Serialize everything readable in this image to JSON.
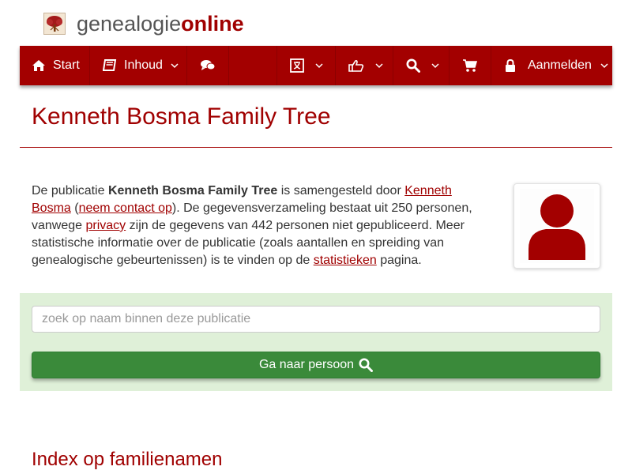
{
  "logo": {
    "part1": "genealogie",
    "part2": "online",
    "icon": "family-tree-icon"
  },
  "nav": {
    "start_label": "Start",
    "inhoud_label": "Inhoud",
    "login_label": "Aanmelden",
    "icons": [
      "home-icon",
      "book-icon",
      "comments-icon",
      "language-icon",
      "thumbs-up-icon",
      "search-icon",
      "cart-icon",
      "lock-icon",
      "chevron-down-icon"
    ]
  },
  "page": {
    "title": "Kenneth Bosma Family Tree"
  },
  "intro": {
    "t1": "De publicatie ",
    "pub_name": "Kenneth Bosma Family Tree",
    "t2": " is samengesteld door ",
    "author": "Kenneth Bosma",
    "t3": " (",
    "contact": "neem contact op",
    "t4": "). De gegevensverzameling bestaat uit 250 personen, vanwege ",
    "privacy": "privacy",
    "t5": " zijn de gegevens van 442 personen niet gepubliceerd. Meer statistische informatie over de publicatie (zoals aantallen en spreiding van genealogische gebeurtenissen) is te vinden op de ",
    "stats": "statistieken",
    "t6": " pagina."
  },
  "search": {
    "placeholder": "zoek op naam binnen deze publicatie",
    "value": "",
    "button_label": "Ga naar persoon"
  },
  "index": {
    "title": "Index op familienamen"
  },
  "colors": {
    "brand": "#a30000",
    "panel": "#dff0d8",
    "button": "#3a8a3a"
  }
}
